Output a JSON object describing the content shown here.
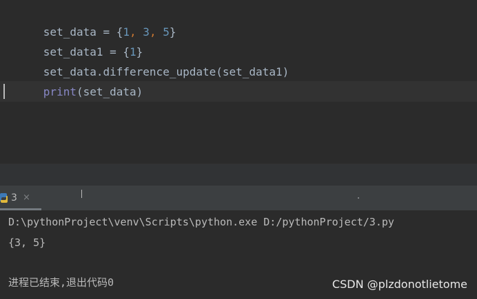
{
  "editor": {
    "lines": [
      {
        "parts": [
          {
            "text": "set_data = {",
            "role": "plain"
          },
          {
            "text": "1",
            "role": "num"
          },
          {
            "text": ", ",
            "role": "punc"
          },
          {
            "text": "3",
            "role": "num"
          },
          {
            "text": ", ",
            "role": "punc"
          },
          {
            "text": "5",
            "role": "num"
          },
          {
            "text": "}",
            "role": "plain"
          }
        ]
      },
      {
        "parts": [
          {
            "text": "set_data1 = {",
            "role": "plain"
          },
          {
            "text": "1",
            "role": "num"
          },
          {
            "text": "}",
            "role": "plain"
          }
        ]
      },
      {
        "parts": [
          {
            "text": "set_data.difference_update(set_data1)",
            "role": "plain"
          }
        ]
      },
      {
        "parts": [
          {
            "text": "print",
            "role": "builtin"
          },
          {
            "text": "(set_data)",
            "role": "plain"
          }
        ]
      }
    ]
  },
  "run_panel": {
    "tab_label": "3",
    "tab_close": "×",
    "tab_icon": "python-icon"
  },
  "console": {
    "command": "D:\\pythonProject\\venv\\Scripts\\python.exe D:/pythonProject/3.py",
    "output": "{3, 5}",
    "exit_message": "进程已结束,退出代码0"
  },
  "watermark": "CSDN @plzdonotlietome",
  "colors": {
    "editor_bg": "#2b2b2b",
    "text": "#a9b7c6",
    "number": "#6897bb",
    "punctuation": "#cc7832",
    "builtin": "#8888c6",
    "console_text": "#bbbbbb"
  }
}
